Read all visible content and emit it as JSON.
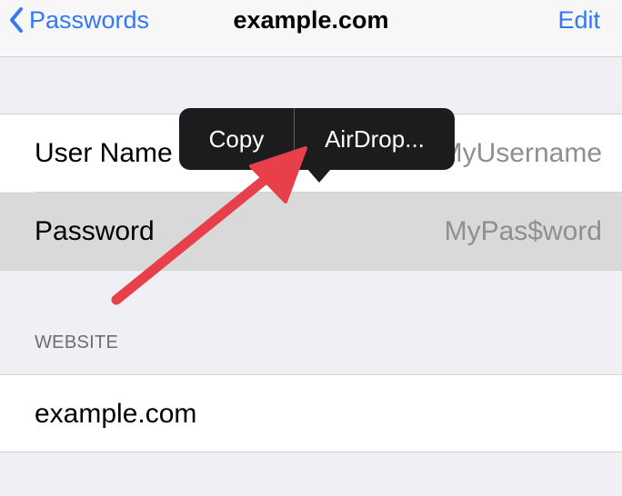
{
  "navbar": {
    "back_label": "Passwords",
    "title": "example.com",
    "edit_label": "Edit"
  },
  "account": {
    "username_label": "User Name",
    "username_value": "MyUsername",
    "password_label": "Password",
    "password_value": "MyPas$word"
  },
  "website_section": {
    "header": "WEBSITE",
    "value": "example.com"
  },
  "callout_menu": {
    "items": [
      "Copy",
      "AirDrop..."
    ]
  },
  "colors": {
    "accent": "#3478f6",
    "callout_bg": "#1c1c1e",
    "annotation_arrow": "#e8404a",
    "selected_row": "#d9d9d9"
  },
  "icons": {
    "back": "chevron-left-icon"
  }
}
